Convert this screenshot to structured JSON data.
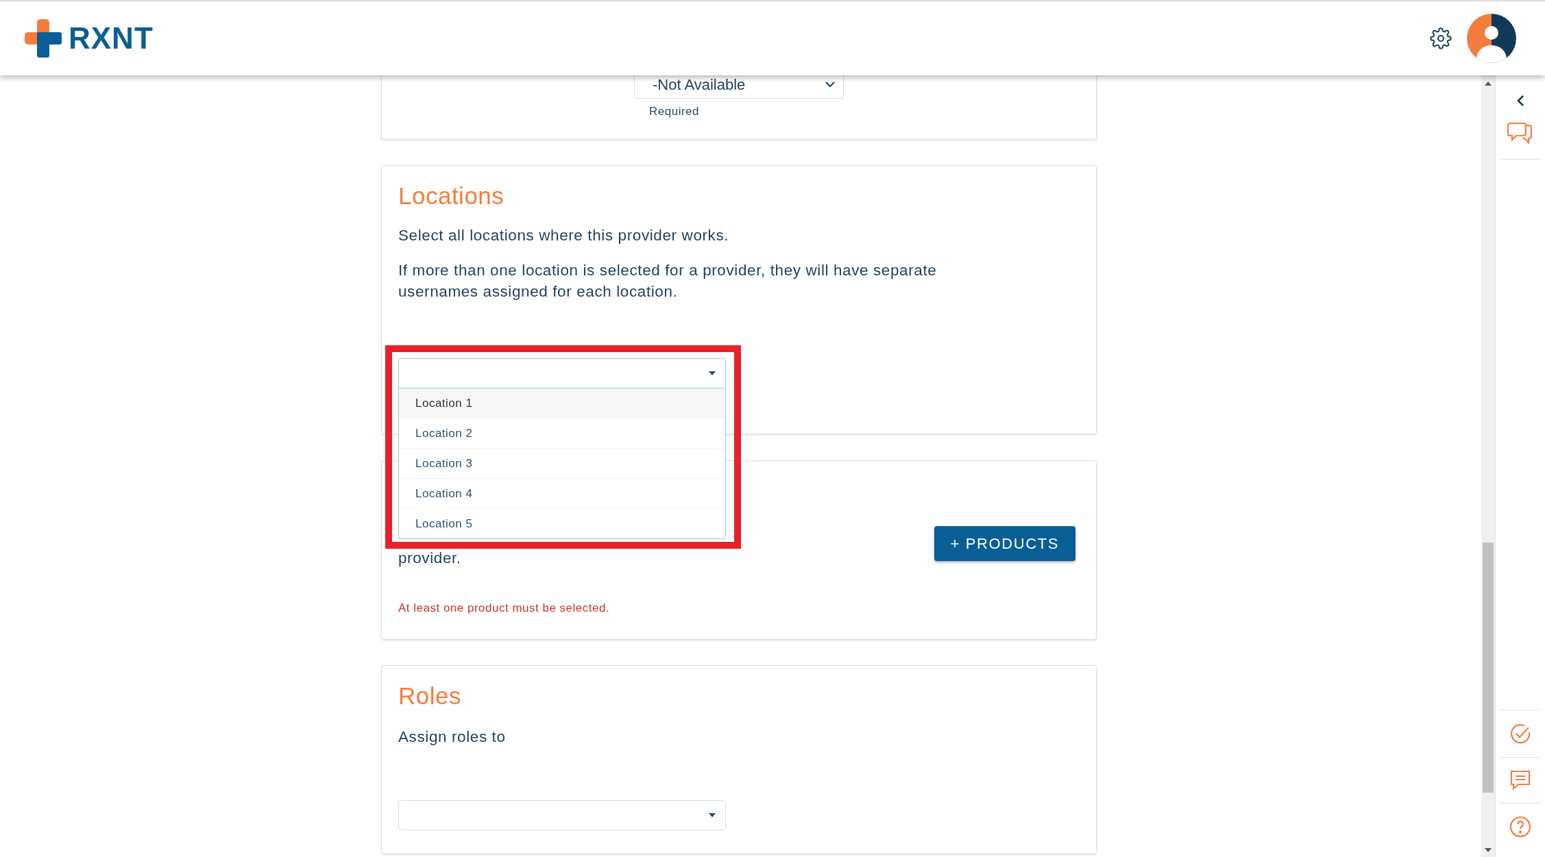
{
  "header": {
    "logo": "RXNT"
  },
  "top_card": {
    "select": {
      "value": "-Not Available"
    },
    "hint": "Required"
  },
  "locations": {
    "title": "Locations",
    "paragraphs": [
      "Select all locations where this provider works.",
      "If more than one location is selected for a provider, they will have separate usernames assigned for each location."
    ],
    "dropdown": {
      "expanded": true,
      "options": [
        {
          "label": "Location 1",
          "highlighted": true
        },
        {
          "label": "Location 2",
          "highlighted": false
        },
        {
          "label": "Location 3",
          "highlighted": false
        },
        {
          "label": "Location 4",
          "highlighted": false
        },
        {
          "label": "Location 5",
          "highlighted": false
        }
      ]
    }
  },
  "products": {
    "text": "provider.",
    "button": "+ PRODUCTS",
    "error": "At least one product must be selected."
  },
  "roles": {
    "title": "Roles",
    "text": "Assign roles to",
    "dropdown": {
      "expanded": false
    }
  }
}
